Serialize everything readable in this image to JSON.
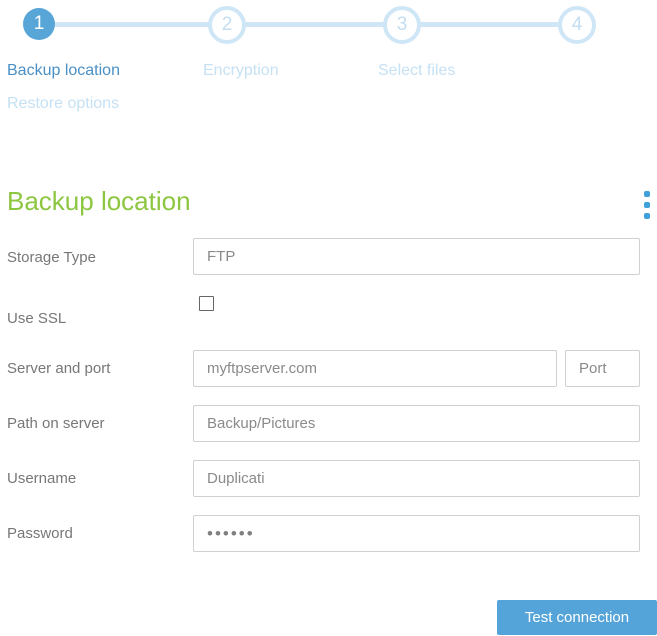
{
  "colors": {
    "accent_blue": "#55a4d9",
    "pale_blue": "#cfe6f7",
    "inactive_label_blue": "#c5e1f4",
    "active_label_blue": "#4a90c5",
    "heading_green": "#8dc640"
  },
  "wizard": {
    "steps": [
      {
        "number": "1",
        "label": "Backup location",
        "active": true
      },
      {
        "number": "2",
        "label": "Encryption",
        "active": false
      },
      {
        "number": "3",
        "label": "Select files",
        "active": false
      },
      {
        "number": "4",
        "label": "Restore options",
        "active": false
      }
    ]
  },
  "page": {
    "title": "Backup location"
  },
  "form": {
    "storage_type": {
      "label": "Storage Type",
      "value": "FTP"
    },
    "use_ssl": {
      "label": "Use SSL",
      "checked": false
    },
    "server": {
      "label": "Server and port",
      "value": "myftpserver.com",
      "port_placeholder": "Port"
    },
    "path": {
      "label": "Path on server",
      "value": "Backup/Pictures"
    },
    "username": {
      "label": "Username",
      "value": "Duplicati"
    },
    "password": {
      "label": "Password",
      "masked_value": "••••••"
    }
  },
  "actions": {
    "test_button": "Test connection"
  }
}
